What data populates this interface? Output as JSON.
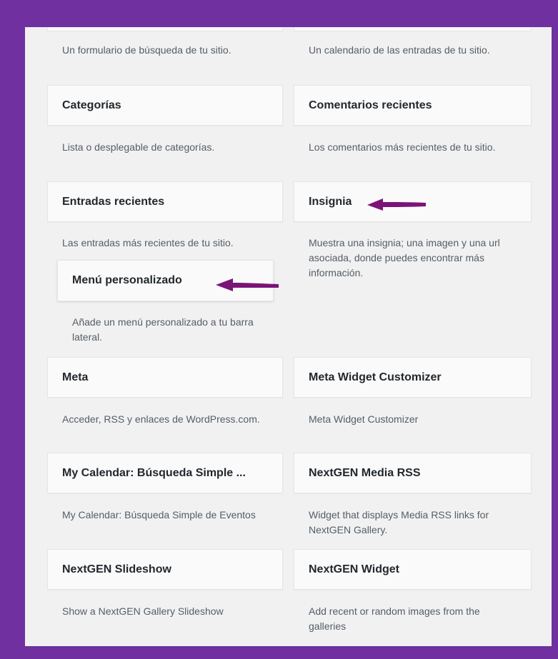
{
  "colors": {
    "frame": "#7030a0",
    "arrow": "#7b1477"
  },
  "widgets": {
    "buscar": {
      "description": "Un formulario de búsqueda de tu sitio."
    },
    "calendario": {
      "description": "Un calendario de las entradas de tu sitio."
    },
    "categorias": {
      "title": "Categorías",
      "description": "Lista o desplegable de categorías."
    },
    "comentarios_recientes": {
      "title": "Comentarios recientes",
      "description": "Los comentarios más recientes de tu sitio."
    },
    "entradas_recientes": {
      "title": "Entradas recientes",
      "description": "Las entradas más recientes de tu sitio."
    },
    "insignia": {
      "title": "Insignia",
      "description": "Muestra una insignia; una imagen y una url asociada, donde puedes encontrar más información."
    },
    "menu_personalizado": {
      "title": "Menú personalizado",
      "description": "Añade un menú personalizado a tu barra lateral."
    },
    "meta": {
      "title": "Meta",
      "description": "Acceder, RSS y enlaces de WordPress.com."
    },
    "meta_widget_customizer": {
      "title": "Meta Widget Customizer",
      "description": "Meta Widget Customizer"
    },
    "my_calendar": {
      "title": "My Calendar: Búsqueda Simple ...",
      "description": "My Calendar: Búsqueda Simple de Eventos"
    },
    "nextgen_media_rss": {
      "title": "NextGEN Media RSS",
      "description": "Widget that displays Media RSS links for NextGEN Gallery."
    },
    "nextgen_slideshow": {
      "title": "NextGEN Slideshow",
      "description": "Show a NextGEN Gallery Slideshow"
    },
    "nextgen_widget": {
      "title": "NextGEN Widget",
      "description": "Add recent or random images from the galleries"
    }
  },
  "annotations": {
    "arrow_icon": "left-arrow-icon"
  }
}
